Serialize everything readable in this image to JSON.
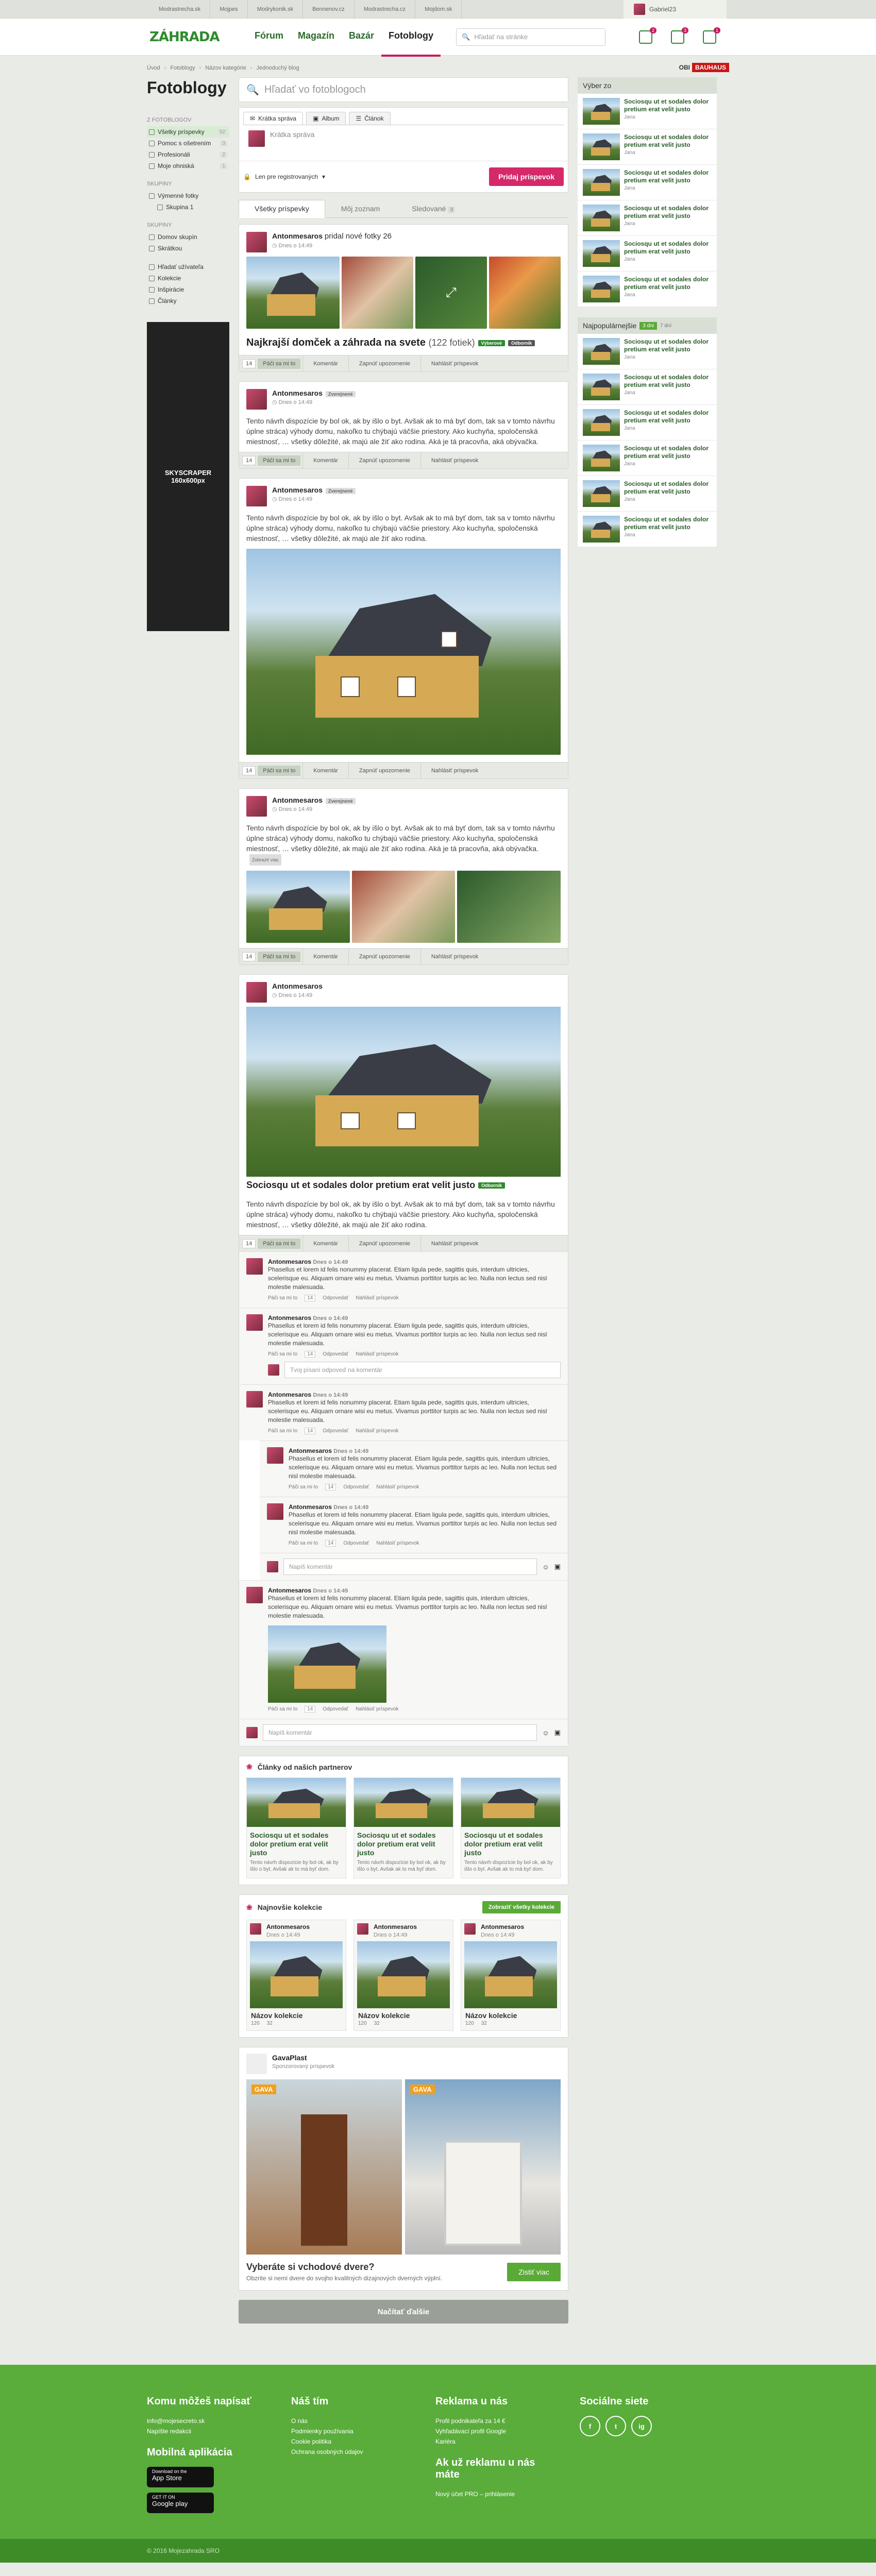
{
  "topbar": {
    "links": [
      "Modrastrecha.sk",
      "Mojpes",
      "Modrykonik.sk",
      "Bennenov.cz",
      "Modrastrecha.cz",
      "Mojdom.sk"
    ],
    "user": "Gabriel23"
  },
  "header": {
    "logo": "ZÁHRADA",
    "logo_accent": "R",
    "nav": [
      "Fórum",
      "Magazín",
      "Bazár",
      "Fotoblogy"
    ],
    "active_nav": 3,
    "search_placeholder": "Hľadať na stránke",
    "badges": [
      "2",
      "3",
      "1"
    ]
  },
  "breadcrumb": [
    "Úvod",
    "Fotoblogy",
    "Názov kategórie",
    "Jednoduchý blog"
  ],
  "obi": {
    "prefix": "OBI",
    "brand": "BAUHAUS"
  },
  "page": {
    "title": "Fotoblogy"
  },
  "left": {
    "sec1": "Z FOTOBLOGOV",
    "items1": [
      {
        "label": "Všetky príspevky",
        "count": "52"
      },
      {
        "label": "Pomoc s ošetrením",
        "count": "3"
      },
      {
        "label": "Profesionáli",
        "count": "2"
      },
      {
        "label": "Moje ohniská",
        "count": "1"
      }
    ],
    "sec2": "SKUPINY",
    "items2": [
      {
        "label": "Výmenné fotky"
      },
      {
        "label": "Skupina 1"
      }
    ],
    "sec3": "SKUPINY",
    "items3": [
      {
        "label": "Domov skupín"
      },
      {
        "label": "Skrátkou"
      }
    ],
    "items4": [
      {
        "label": "Hľadať užívateľa"
      },
      {
        "label": "Kolekcie"
      },
      {
        "label": "Inšpirácie"
      },
      {
        "label": "Články"
      }
    ],
    "ad_title": "SKYSCRAPER",
    "ad_size": "160x600px"
  },
  "main": {
    "search_placeholder": "Hľadať vo fotoblogoch",
    "composer": {
      "tabs": [
        "Krátka správa",
        "Album",
        "Článok"
      ],
      "placeholder": "Krátka správa",
      "visibility": "Len pre registrovaných",
      "submit": "Pridaj príspevok"
    },
    "filter_tabs": [
      {
        "label": "Všetky príspevky"
      },
      {
        "label": "Môj zoznam"
      },
      {
        "label": "Sledované",
        "n": "3"
      }
    ],
    "author": "Antonmesaros",
    "time": "Dnes o 14:49",
    "like": "Páči sa mi to",
    "comment": "Komentár",
    "report": "Zapnúť upozornenie",
    "hide": "Nahlásiť príspevok",
    "p1": {
      "action": "pridal nové fotky 26",
      "title": "Najkrajší domček a záhrada na svete",
      "title_count": "(122 fotiek)",
      "tag1": "Výberové",
      "tag2": "Odborník",
      "likes": "14"
    },
    "text_long": "Tento návrh dispozície by bol ok, ak by išlo o byt. Avšak ak to má byť dom, tak sa v tomto návrhu úplne stráca) výhody domu, nakoľko tu chýbajú väčšie priestory. Ako kuchyňa, spoločenská miestnosť, … všetky dôležité, ak majú ale žiť ako rodina. Aká je tá pracovňa, aká obývačka.",
    "text_short": "Tento návrh dispozície by bol ok, ak by išlo o byt. Avšak ak to má byť dom, tak sa v tomto návrhu úplne stráca) výhody domu, nakoľko tu chýbajú väčšie priestory. Ako kuchyňa, spoločenská miestnosť, … všetky dôležité, ak majú ale žiť ako rodina.",
    "p4_more": "Zobraziť viac",
    "p4_tag": "Zverejnené",
    "p5": {
      "title": "Sociosqu ut et sodales dolor pretium erat velit justo",
      "tag": "Odborník"
    },
    "comment_text": "Phasellus et lorem id felis nonummy placerat. Etiam ligula pede, sagittis quis, interdum ultricies, scelerisque eu. Aliquam ornare wisi eu metus. Vivamus porttitor turpis ac leo. Nulla non lectus sed nisl molestie malesuada.",
    "comment_like": "Páči sa mi to",
    "comment_count": "14",
    "comment_reply": "Odpovedať",
    "comment_report": "Nahlásiť príspevok",
    "reply_placeholder": "Tvoj písaní odpoveď na komentár",
    "write_placeholder": "Napíš komentár",
    "partners": {
      "title": "Články od našich partnerov",
      "items": [
        {
          "t": "Sociosqu ut et sodales dolor pretium erat velit justo",
          "d": "Tento návrh dispozície by bol ok, ak by išlo o byt. Avšak ak to má byť dom."
        },
        {
          "t": "Sociosqu ut et sodales dolor pretium erat velit justo",
          "d": "Tento návrh dispozície by bol ok, ak by išlo o byt. Avšak ak to má byť dom."
        },
        {
          "t": "Sociosqu ut et sodales dolor pretium erat velit justo",
          "d": "Tento návrh dispozície by bol ok, ak by išlo o byt. Avšak ak to má byť dom."
        }
      ]
    },
    "kolekcie": {
      "title": "Najnovšie kolekcie",
      "btn": "Zobraziť všetky kolekcie",
      "items": [
        {
          "n": "Názov kolekcie",
          "a": "120",
          "b": "32"
        },
        {
          "n": "Názov kolekcie",
          "a": "120",
          "b": "32"
        },
        {
          "n": "Názov kolekcie",
          "a": "120",
          "b": "32"
        }
      ]
    },
    "gava": {
      "name": "GavaPlast",
      "sub": "Sponzorovaný príspevok",
      "label1": "GAVA",
      "label2": "GAVA",
      "h": "Vyberáte si vchodové dvere?",
      "d": "Obzrite si nemi dvere do svojho kvalitných dizajnových dverných výplní.",
      "btn": "Zistiť viac"
    },
    "load_more": "Načítať ďalšie"
  },
  "right": {
    "sec1": "Výber zo",
    "sec2": "Najpopulárnejšie",
    "tab2a": "3 dni",
    "tab2b": "7 dní",
    "item_title": "Sociosqu ut et sodales dolor pretium erat velit justo",
    "item_meta": "Jana"
  },
  "footer": {
    "c1": {
      "h": "Komu môžeš napísať",
      "links": [
        "info@mojesecreto.sk",
        "Napíšte redakcii"
      ]
    },
    "c1b": {
      "h": "Mobilná aplikácia",
      "s1a": "Download on the",
      "s1b": "App Store",
      "s2a": "GET IT ON",
      "s2b": "Google play"
    },
    "c2": {
      "h": "Náš tím",
      "links": [
        "O nás",
        "Podmienky používania",
        "Cookie politika",
        "Ochrana osobných údajov"
      ]
    },
    "c3": {
      "h": "Reklama u nás",
      "links": [
        "Profil podnikateľa za 14 €",
        "Vyhľadávací profil Google",
        "Kariéra"
      ]
    },
    "c3b": {
      "h": "Ak už reklamu u nás máte",
      "links": [
        "Nový účet PRO – prihlásenie"
      ]
    },
    "c4": {
      "h": "Sociálne siete",
      "icons": [
        "f",
        "t",
        "ig"
      ]
    },
    "copy": "© 2016 Mojezahrada SRO"
  }
}
